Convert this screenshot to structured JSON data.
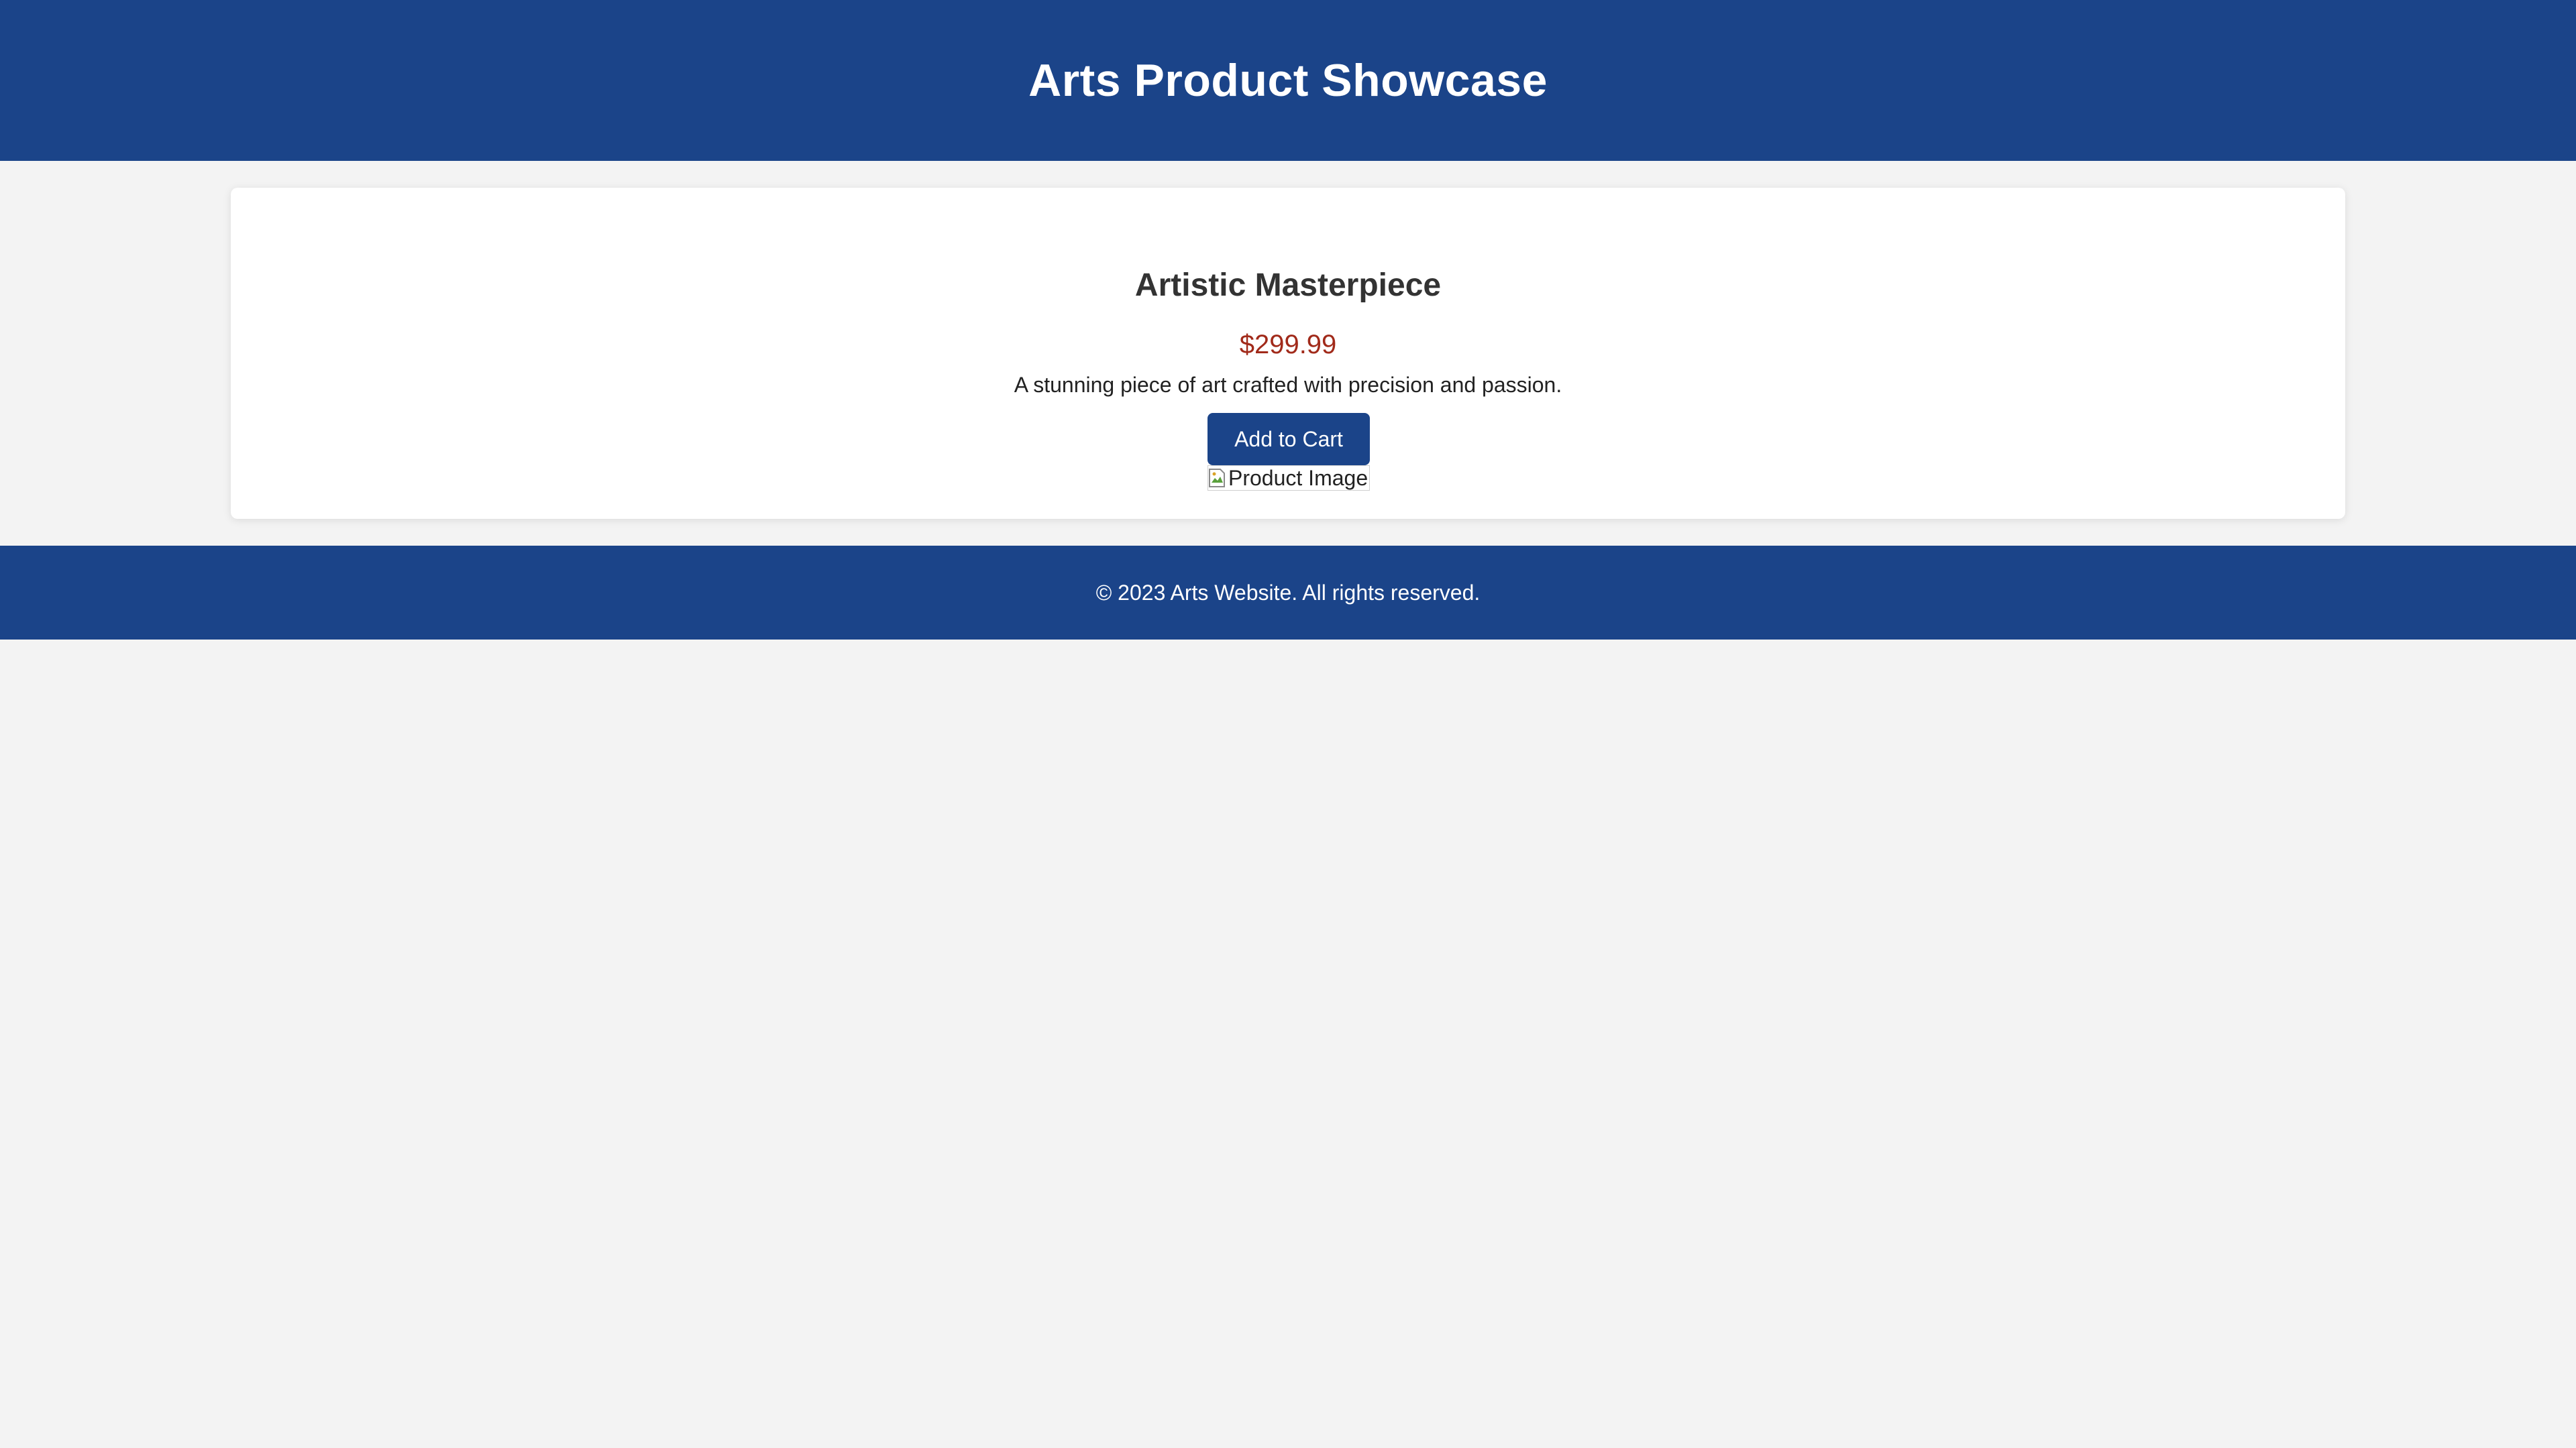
{
  "header": {
    "title": "Arts Product Showcase"
  },
  "product": {
    "title": "Artistic Masterpiece",
    "price": "$299.99",
    "description": "A stunning piece of art crafted with precision and passion.",
    "add_to_cart_label": "Add to Cart",
    "image_alt": "Product Image",
    "image_icon": "broken-image-icon"
  },
  "footer": {
    "copyright": "© 2023 Arts Website. All rights reserved."
  },
  "colors": {
    "brand": "#1b4489",
    "price": "#a12a1a",
    "background": "#f3f3f3",
    "card": "#ffffff"
  }
}
